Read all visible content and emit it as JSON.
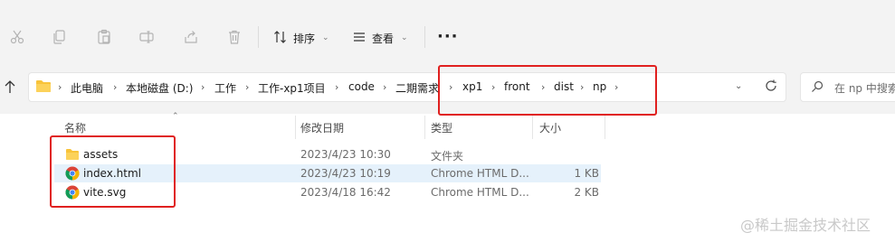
{
  "toolbar": {
    "sort_label": "排序",
    "view_label": "查看",
    "more_label": "···",
    "icons": [
      "cut-icon",
      "copy-icon",
      "paste-icon",
      "rename-icon",
      "share-icon",
      "delete-icon",
      "sort-icon",
      "view-icon"
    ]
  },
  "address": {
    "crumbs": [
      "此电脑",
      "本地磁盘 (D:)",
      "工作",
      "工作-xp1项目",
      "code",
      "二期需求",
      "xp1",
      "front",
      "dist",
      "np"
    ],
    "separator": "›",
    "dropdown_glyph": "⌄",
    "search_placeholder": "在 np 中搜索"
  },
  "columns": {
    "name": "名称",
    "modified": "修改日期",
    "type": "类型",
    "size": "大小"
  },
  "files": [
    {
      "name": "assets",
      "modified": "2023/4/23 10:30",
      "type": "文件夹",
      "size": "",
      "icon": "folder-icon",
      "selected": false
    },
    {
      "name": "index.html",
      "modified": "2023/4/23 10:19",
      "type": "Chrome HTML D...",
      "size": "1 KB",
      "icon": "chrome-icon",
      "selected": true
    },
    {
      "name": "vite.svg",
      "modified": "2023/4/18 16:42",
      "type": "Chrome HTML D...",
      "size": "2 KB",
      "icon": "chrome-icon",
      "selected": false
    }
  ],
  "watermark": "@稀土掘金技术社区",
  "colors": {
    "highlight_red": "#e0201f",
    "selected_row": "#e5f1fb",
    "folder_yellow": "#f8c33a"
  }
}
